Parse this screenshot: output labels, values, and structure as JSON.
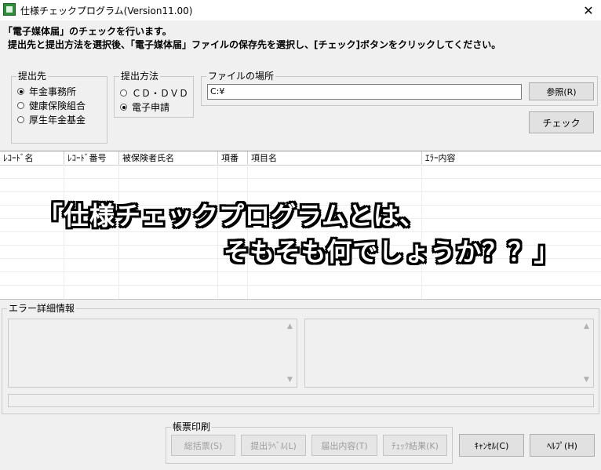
{
  "window": {
    "title": "仕様チェックプログラム(Version11.00)",
    "close_symbol": "✕"
  },
  "instructions": {
    "line1": "「電子媒体届」のチェックを行います。",
    "line2": "提出先と提出方法を選択後、「電子媒体届」ファイルの保存先を選択し、[チェック]ボタンをクリックしてください。"
  },
  "submit_to": {
    "title": "提出先",
    "options": [
      {
        "label": "年金事務所",
        "selected": true
      },
      {
        "label": "健康保険組合",
        "selected": false
      },
      {
        "label": "厚生年金基金",
        "selected": false
      }
    ]
  },
  "method": {
    "title": "提出方法",
    "options": [
      {
        "label": "ＣＤ・ＤＶＤ",
        "selected": false
      },
      {
        "label": "電子申請",
        "selected": true
      }
    ]
  },
  "file": {
    "title": "ファイルの場所",
    "path": "C:¥",
    "browse_label": "参照(R)"
  },
  "check_label": "チェック",
  "table": {
    "columns": [
      "ﾚｺｰﾄﾞ名",
      "ﾚｺｰﾄﾞ番号",
      "被保険者氏名",
      "項番",
      "項目名",
      "ｴﾗｰ内容"
    ]
  },
  "overlay": {
    "line1": "「仕様チェックプログラムとは、",
    "line2": "そもそも何でしょうか？？」"
  },
  "error_detail": {
    "title": "エラー詳細情報"
  },
  "print": {
    "title": "帳票印刷",
    "buttons": [
      "総括票(S)",
      "提出ﾗﾍﾞﾙ(L)",
      "届出内容(T)",
      "ﾁｪｯｸ結果(K)"
    ]
  },
  "cancel_label": "ｷｬﾝｾﾙ(C)",
  "help_label": "ﾍﾙﾌﾟ(H)"
}
